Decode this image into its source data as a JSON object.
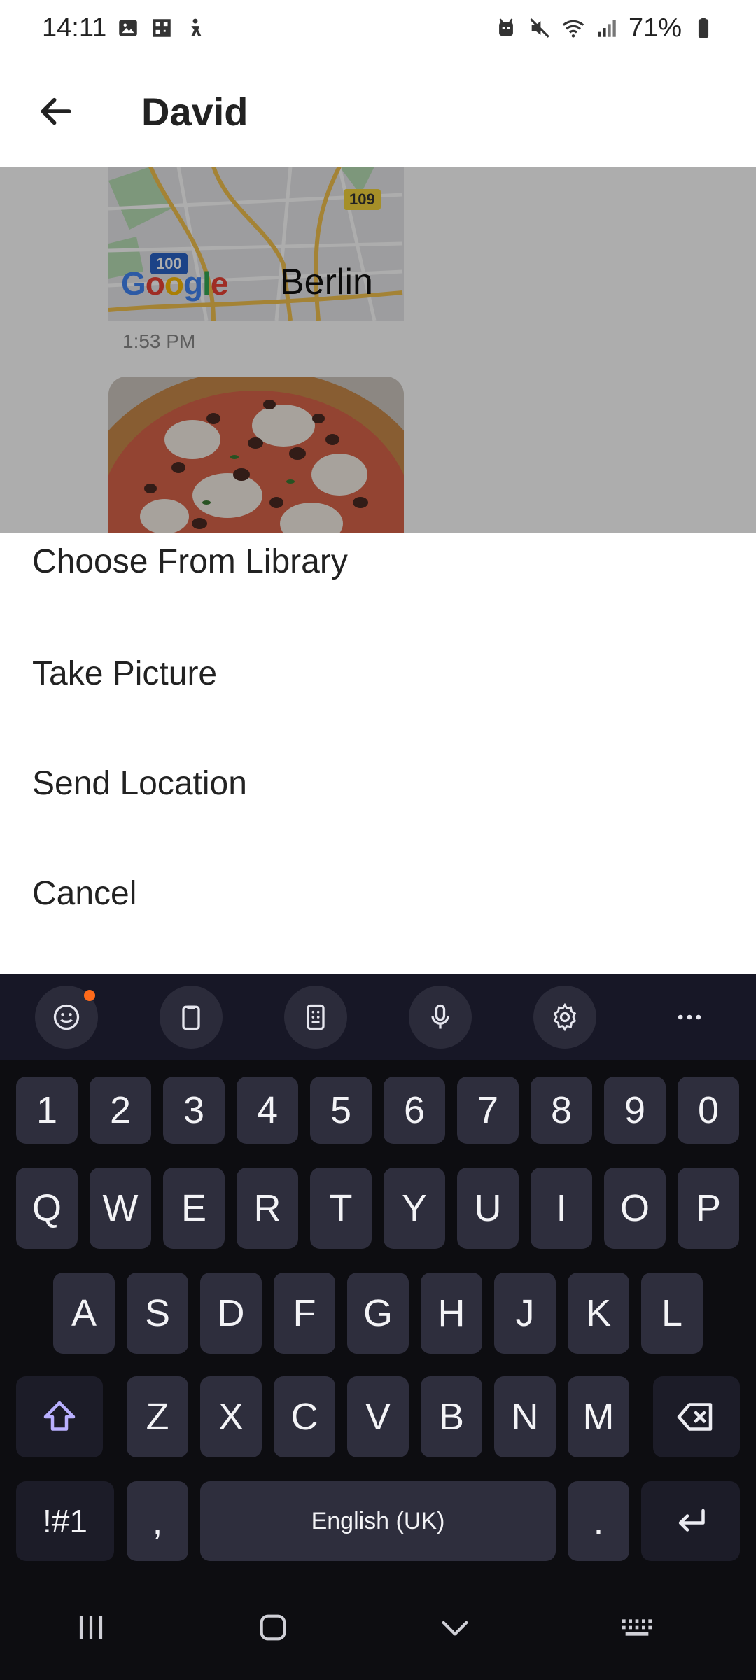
{
  "status_bar": {
    "time": "14:11",
    "battery": "71%",
    "icons_left": [
      "gallery-icon",
      "qr-icon",
      "accessibility-icon"
    ],
    "icons_right": [
      "android-icon",
      "mute-icon",
      "wifi-icon",
      "signal-icon",
      "battery-icon"
    ]
  },
  "header": {
    "title": "David",
    "back_icon": "arrow-left-icon"
  },
  "chat": {
    "map": {
      "city": "Berlin",
      "logo": "Google",
      "road_badges": [
        "109",
        "100"
      ]
    },
    "time": "1:53 PM"
  },
  "action_sheet": {
    "items": [
      "Choose From Library",
      "Take Picture",
      "Send Location",
      "Cancel"
    ]
  },
  "keyboard": {
    "toolbar": [
      "emoji-icon",
      "clipboard-icon",
      "keypad-icon",
      "microphone-icon",
      "settings-icon",
      "more-icon"
    ],
    "row_numbers": [
      "1",
      "2",
      "3",
      "4",
      "5",
      "6",
      "7",
      "8",
      "9",
      "0"
    ],
    "row1": [
      "Q",
      "W",
      "E",
      "R",
      "T",
      "Y",
      "U",
      "I",
      "O",
      "P"
    ],
    "row2": [
      "A",
      "S",
      "D",
      "F",
      "G",
      "H",
      "J",
      "K",
      "L"
    ],
    "row3": [
      "Z",
      "X",
      "C",
      "V",
      "B",
      "N",
      "M"
    ],
    "symbols": "!#1",
    "comma": ",",
    "space": "English (UK)",
    "period": "."
  },
  "nav": [
    "recents-icon",
    "home-icon",
    "hide-keyboard-icon",
    "keyboard-icon"
  ]
}
